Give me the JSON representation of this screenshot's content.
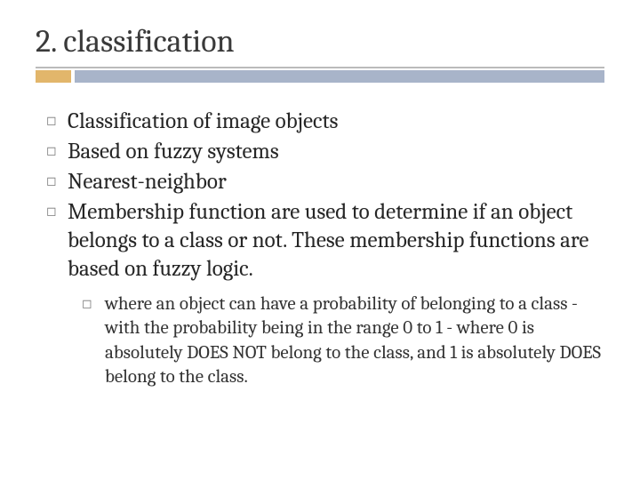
{
  "title": "2. classification",
  "bullets": [
    {
      "text": "Classification of image objects"
    },
    {
      "text": "Based on fuzzy systems"
    },
    {
      "text": "Nearest-neighbor"
    },
    {
      "text": "Membership function are used to determine if an object belongs to a class or not. These membership functions are based on fuzzy logic."
    }
  ],
  "subbullets": [
    {
      "text": "where an object can have a probability of belonging to a class - with the probability being in the range 0 to 1 - where 0 is absolutely DOES NOT belong to the class, and 1 is absolutely DOES belong to the class."
    }
  ],
  "glyphs": {
    "bullet": "◻",
    "subbullet": "◻"
  }
}
